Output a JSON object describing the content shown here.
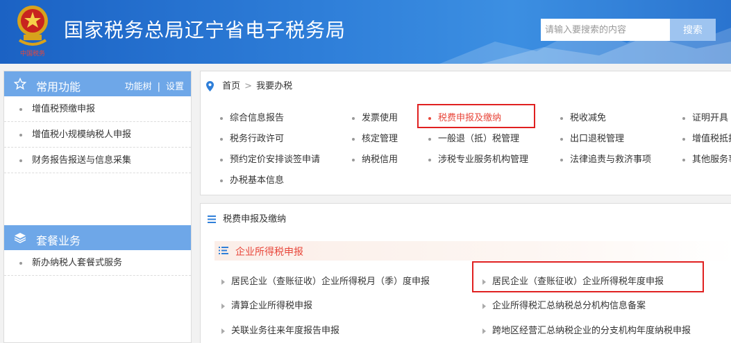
{
  "header": {
    "title": "国家税务总局辽宁省电子税务局",
    "emblem_caption": "中国税务",
    "search_placeholder": "请输入要搜索的内容",
    "search_button": "搜索"
  },
  "sidebar": {
    "common": {
      "title": "常用功能",
      "link_tree": "功能树",
      "separator": "|",
      "link_settings": "设置",
      "items": [
        "增值税预缴申报",
        "增值税小规模纳税人申报",
        "财务报告报送与信息采集"
      ]
    },
    "packages": {
      "title": "套餐业务",
      "items": [
        "新办纳税人套餐式服务"
      ]
    }
  },
  "breadcrumb": {
    "home": "首页",
    "sep": ">",
    "current": "我要办税"
  },
  "nav": {
    "row1": [
      "综合信息报告",
      "发票使用",
      "税费申报及缴纳",
      "税收减免",
      "证明开具"
    ],
    "row2": [
      "税务行政许可",
      "核定管理",
      "一般退（抵）税管理",
      "出口退税管理",
      "增值税抵扣"
    ],
    "row3": [
      "预约定价安排谈签申请",
      "纳税信用",
      "涉税专业服务机构管理",
      "法律追责与救济事项",
      "其他服务事"
    ],
    "row4": [
      "办税基本信息"
    ],
    "active": "税费申报及缴纳"
  },
  "detail": {
    "title": "税费申报及缴纳",
    "category": "企业所得税申报",
    "items_left": [
      "居民企业（查账征收）企业所得税月（季）度申报",
      "清算企业所得税申报",
      "关联业务往来年度报告申报"
    ],
    "items_right": [
      "居民企业（查账征收）企业所得税年度申报",
      "企业所得税汇总纳税总分机构信息备案",
      "跨地区经营汇总纳税企业的分支机构年度纳税申报"
    ]
  },
  "colors": {
    "header_blue": "#2f7fd9",
    "sidebar_head": "#6ea7e8",
    "accent_red": "#e8473b",
    "highlight_box": "#e02020"
  }
}
